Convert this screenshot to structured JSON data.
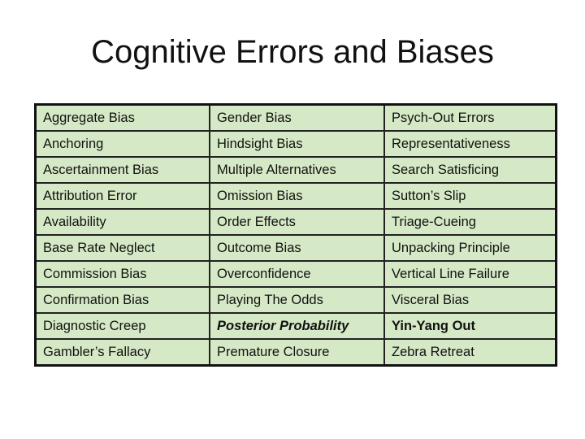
{
  "title": "Cognitive Errors and Biases",
  "colors": {
    "cell_background": "#d6e9c6",
    "border": "#111111"
  },
  "rows": [
    [
      "Aggregate Bias",
      "Gender Bias",
      "Psych-Out Errors"
    ],
    [
      "Anchoring",
      "Hindsight Bias",
      "Representativeness"
    ],
    [
      "Ascertainment Bias",
      "Multiple Alternatives",
      "Search Satisficing"
    ],
    [
      "Attribution Error",
      "Omission Bias",
      "Sutton’s Slip"
    ],
    [
      "Availability",
      "Order Effects",
      "Triage-Cueing"
    ],
    [
      "Base Rate Neglect",
      "Outcome Bias",
      "Unpacking Principle"
    ],
    [
      "Commission Bias",
      "Overconfidence",
      "Vertical Line Failure"
    ],
    [
      "Confirmation Bias",
      "Playing The Odds",
      "Visceral Bias"
    ],
    [
      "Diagnostic Creep",
      "Posterior Probability",
      "Yin-Yang Out"
    ],
    [
      "Gambler’s Fallacy",
      "Premature Closure",
      "Zebra Retreat"
    ]
  ],
  "emphasis": {
    "bold_italic": [
      "Posterior Probability"
    ],
    "bold": [
      "Yin-Yang Out"
    ]
  }
}
